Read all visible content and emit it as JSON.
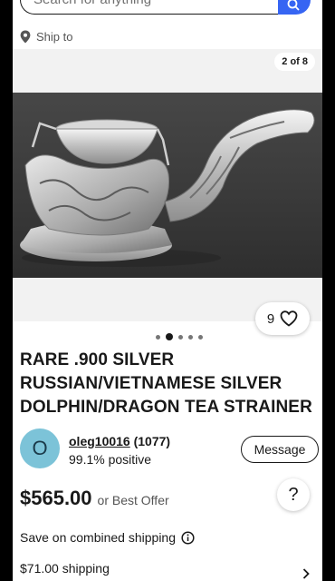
{
  "search": {
    "placeholder": "Search for anything"
  },
  "ship_to": {
    "label": "Ship to"
  },
  "gallery": {
    "counter": "2 of 8",
    "watch_count": "9",
    "dots_total": 5,
    "dots_active_index": 1
  },
  "listing": {
    "title": "RARE .900 SILVER RUSSIAN/VIETNAMESE SILVER DOLPHIN/DRAGON TEA STRAINER"
  },
  "seller": {
    "initial": "O",
    "username": "oleg10016",
    "feedback_count": "(1077)",
    "positive": "99.1% positive",
    "message_label": "Message"
  },
  "help": {
    "label": "?"
  },
  "price": {
    "amount": "$565.00",
    "offer_text": "or Best Offer"
  },
  "shipping": {
    "combined_label": "Save on combined shipping",
    "cost": "$71.00 shipping"
  },
  "colors": {
    "accent_blue": "#3665f3",
    "avatar_bg": "#7cc3d8",
    "text": "#191919"
  }
}
